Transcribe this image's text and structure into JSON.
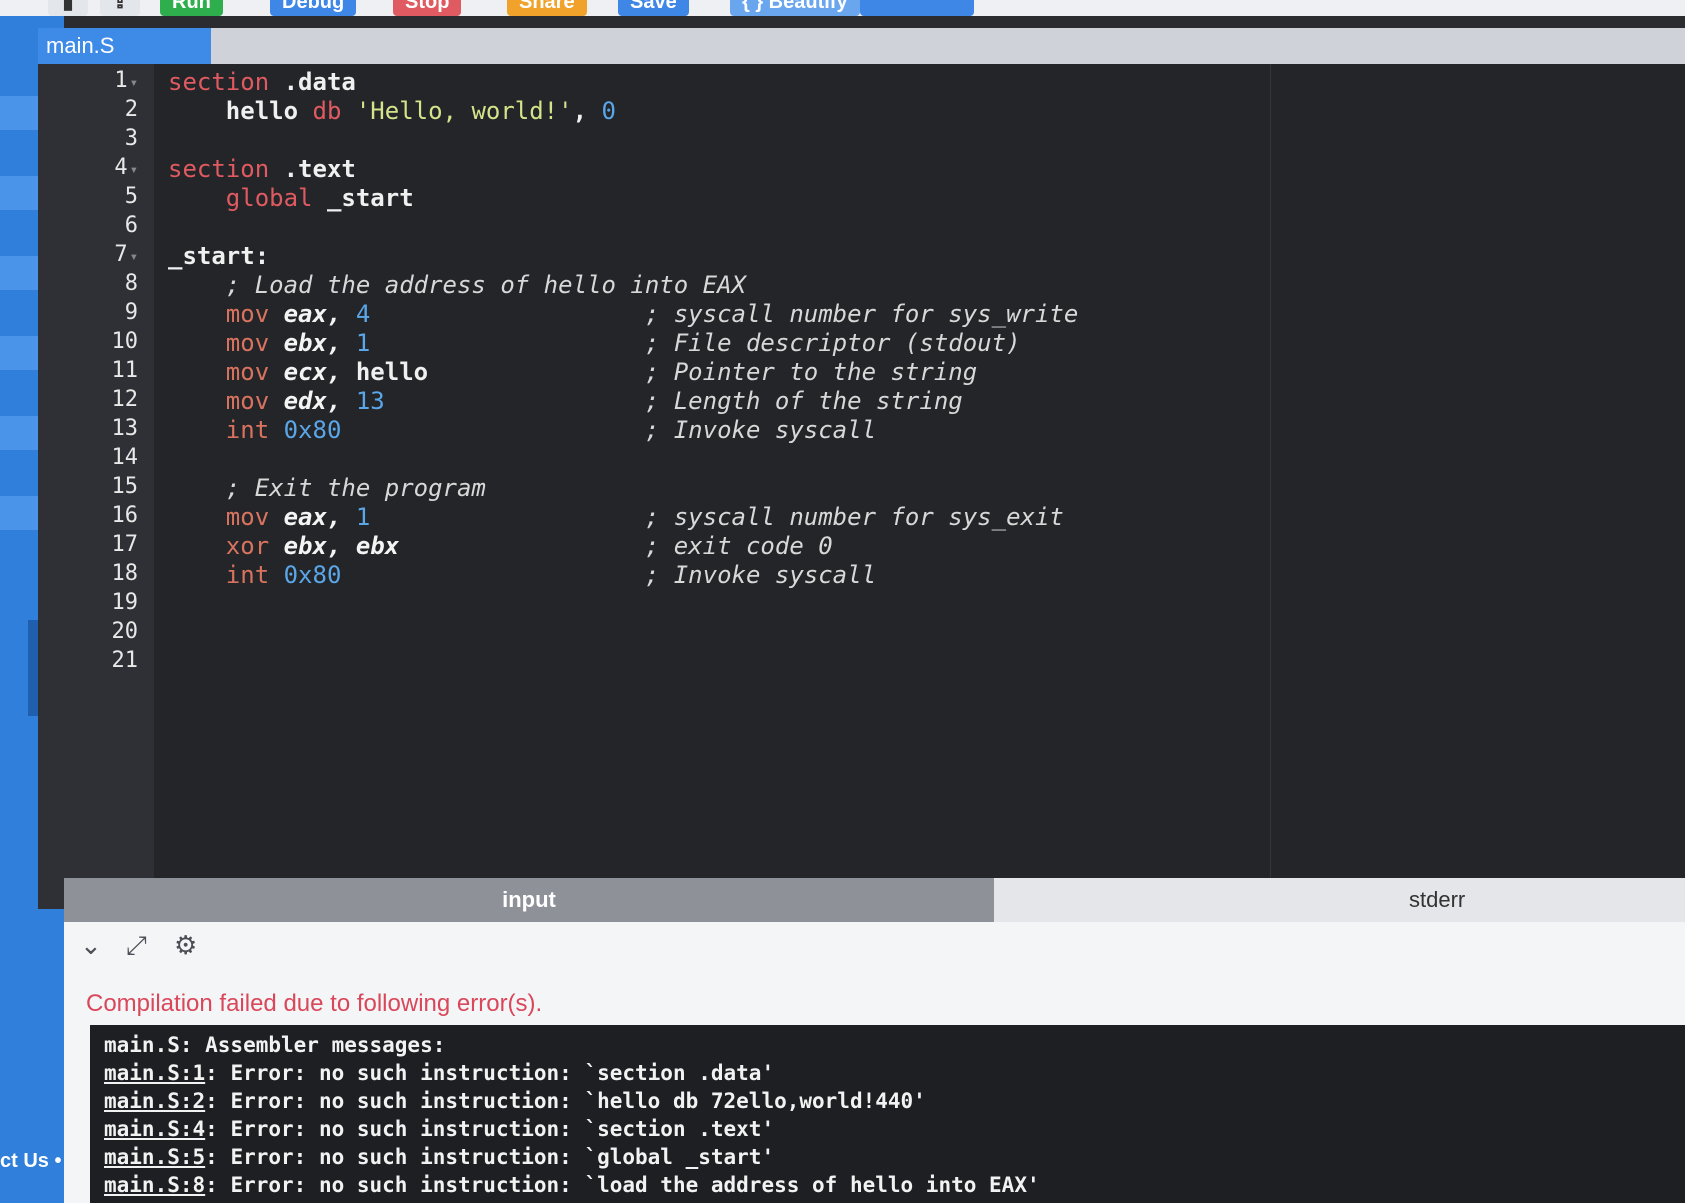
{
  "toolbar": {
    "buttons": [
      {
        "label": "Run",
        "color": "#2fae4e"
      },
      {
        "label": "Debug",
        "color": "#3f87e6"
      },
      {
        "label": "Stop",
        "color": "#e05a61"
      },
      {
        "label": "Share",
        "color": "#f0a22a"
      },
      {
        "label": "Save",
        "color": "#3f87e6"
      },
      {
        "label": "{ } Beautify",
        "color": "#6aa6ee"
      }
    ]
  },
  "sidebar": {
    "contact_label": "ct Us •"
  },
  "editor": {
    "tab_label": "main.S",
    "line_numbers": [
      "1",
      "2",
      "3",
      "4",
      "5",
      "6",
      "7",
      "8",
      "9",
      "10",
      "11",
      "12",
      "13",
      "14",
      "15",
      "16",
      "17",
      "18",
      "19",
      "20",
      "21"
    ],
    "fold_markers": {
      "1": "▾",
      "4": "▾",
      "7": "▾"
    },
    "lines": [
      [
        {
          "t": "section",
          "c": "kw"
        },
        {
          "t": " .data",
          "c": "bold"
        }
      ],
      [
        {
          "t": "    hello",
          "c": "bold"
        },
        {
          "t": " db ",
          "c": "kw"
        },
        {
          "t": "'Hello, world!'",
          "c": "str"
        },
        {
          "t": ", ",
          "c": "bold"
        },
        {
          "t": "0",
          "c": "num"
        }
      ],
      [],
      [
        {
          "t": "section",
          "c": "kw"
        },
        {
          "t": " .text",
          "c": "bold"
        }
      ],
      [
        {
          "t": "    global",
          "c": "kw"
        },
        {
          "t": " _start",
          "c": "bold"
        }
      ],
      [],
      [
        {
          "t": "_start:",
          "c": "bold"
        }
      ],
      [
        {
          "t": "    ; Load the address of hello into EAX",
          "c": "cmt"
        }
      ],
      [
        {
          "t": "    mov ",
          "c": "op"
        },
        {
          "t": "eax, ",
          "c": "reg"
        },
        {
          "t": "4",
          "c": "num"
        },
        {
          "t": "                   ; syscall number for sys_write",
          "c": "cmt"
        }
      ],
      [
        {
          "t": "    mov ",
          "c": "op"
        },
        {
          "t": "ebx, ",
          "c": "reg"
        },
        {
          "t": "1",
          "c": "num"
        },
        {
          "t": "                   ; File descriptor (stdout)",
          "c": "cmt"
        }
      ],
      [
        {
          "t": "    mov ",
          "c": "op"
        },
        {
          "t": "ecx, ",
          "c": "reg"
        },
        {
          "t": "hello",
          "c": "bold"
        },
        {
          "t": "               ; Pointer to the string",
          "c": "cmt"
        }
      ],
      [
        {
          "t": "    mov ",
          "c": "op"
        },
        {
          "t": "edx, ",
          "c": "reg"
        },
        {
          "t": "13",
          "c": "num"
        },
        {
          "t": "                  ; Length of the string",
          "c": "cmt"
        }
      ],
      [
        {
          "t": "    int ",
          "c": "op"
        },
        {
          "t": "0x80",
          "c": "num"
        },
        {
          "t": "                     ; Invoke syscall",
          "c": "cmt"
        }
      ],
      [],
      [
        {
          "t": "    ; Exit the program",
          "c": "cmt"
        }
      ],
      [
        {
          "t": "    mov ",
          "c": "op"
        },
        {
          "t": "eax, ",
          "c": "reg"
        },
        {
          "t": "1",
          "c": "num"
        },
        {
          "t": "                   ; syscall number for sys_exit",
          "c": "cmt"
        }
      ],
      [
        {
          "t": "    xor ",
          "c": "op"
        },
        {
          "t": "ebx, ebx",
          "c": "reg"
        },
        {
          "t": "                 ; exit code 0",
          "c": "cmt"
        }
      ],
      [
        {
          "t": "    int ",
          "c": "op"
        },
        {
          "t": "0x80",
          "c": "num"
        },
        {
          "t": "                     ; Invoke syscall",
          "c": "cmt"
        }
      ],
      [],
      [],
      []
    ]
  },
  "io": {
    "tab_input": "input",
    "tab_stderr": "stderr"
  },
  "output": {
    "error_title": "Compilation failed due to following error(s).",
    "terminal_lines": [
      {
        "ref": "",
        "text": "main.S: Assembler messages:"
      },
      {
        "ref": "main.S:1",
        "text": ": Error: no such instruction: `section .data'"
      },
      {
        "ref": "main.S:2",
        "text": ": Error: no such instruction: `hello db 72ello,world!440'"
      },
      {
        "ref": "main.S:4",
        "text": ": Error: no such instruction: `section .text'"
      },
      {
        "ref": "main.S:5",
        "text": ": Error: no such instruction: `global _start'"
      },
      {
        "ref": "main.S:8",
        "text": ": Error: no such instruction: `load the address of hello into EAX'"
      }
    ]
  },
  "colors": {
    "accent_blue": "#2f7fdb",
    "error_red": "#d9475a",
    "editor_bg": "#232528"
  }
}
